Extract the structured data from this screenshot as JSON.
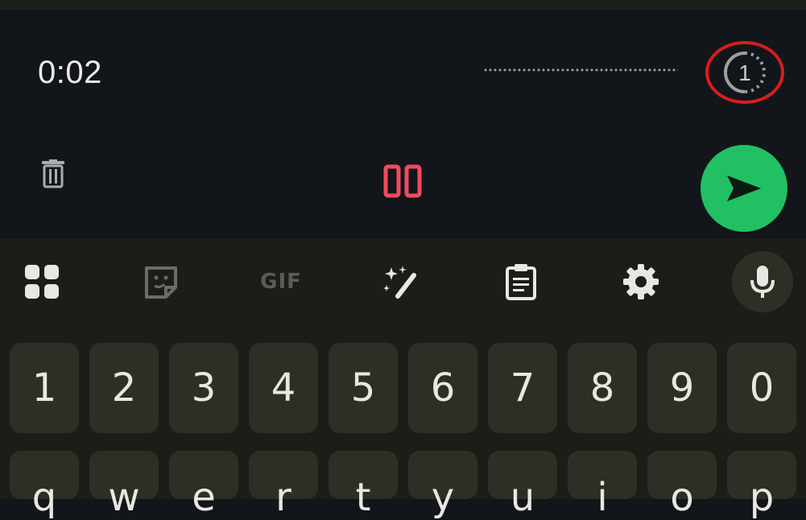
{
  "recorder": {
    "elapsed": "0:02",
    "view_once_label": "1"
  },
  "keyboard": {
    "toolbar": {
      "gif_label": "GIF"
    },
    "number_row": [
      "1",
      "2",
      "3",
      "4",
      "5",
      "6",
      "7",
      "8",
      "9",
      "0"
    ],
    "letter_row": [
      "q",
      "w",
      "e",
      "r",
      "t",
      "y",
      "u",
      "i",
      "o",
      "p"
    ]
  },
  "colors": {
    "send_green": "#21c063",
    "pause_red": "#ef4c5c",
    "highlight_red": "#d81d1d"
  },
  "icons": [
    "trash-icon",
    "pause-icon",
    "send-icon",
    "view-once-icon",
    "apps-grid-icon",
    "sticker-icon",
    "magic-wand-icon",
    "clipboard-icon",
    "settings-gear-icon",
    "microphone-icon"
  ]
}
